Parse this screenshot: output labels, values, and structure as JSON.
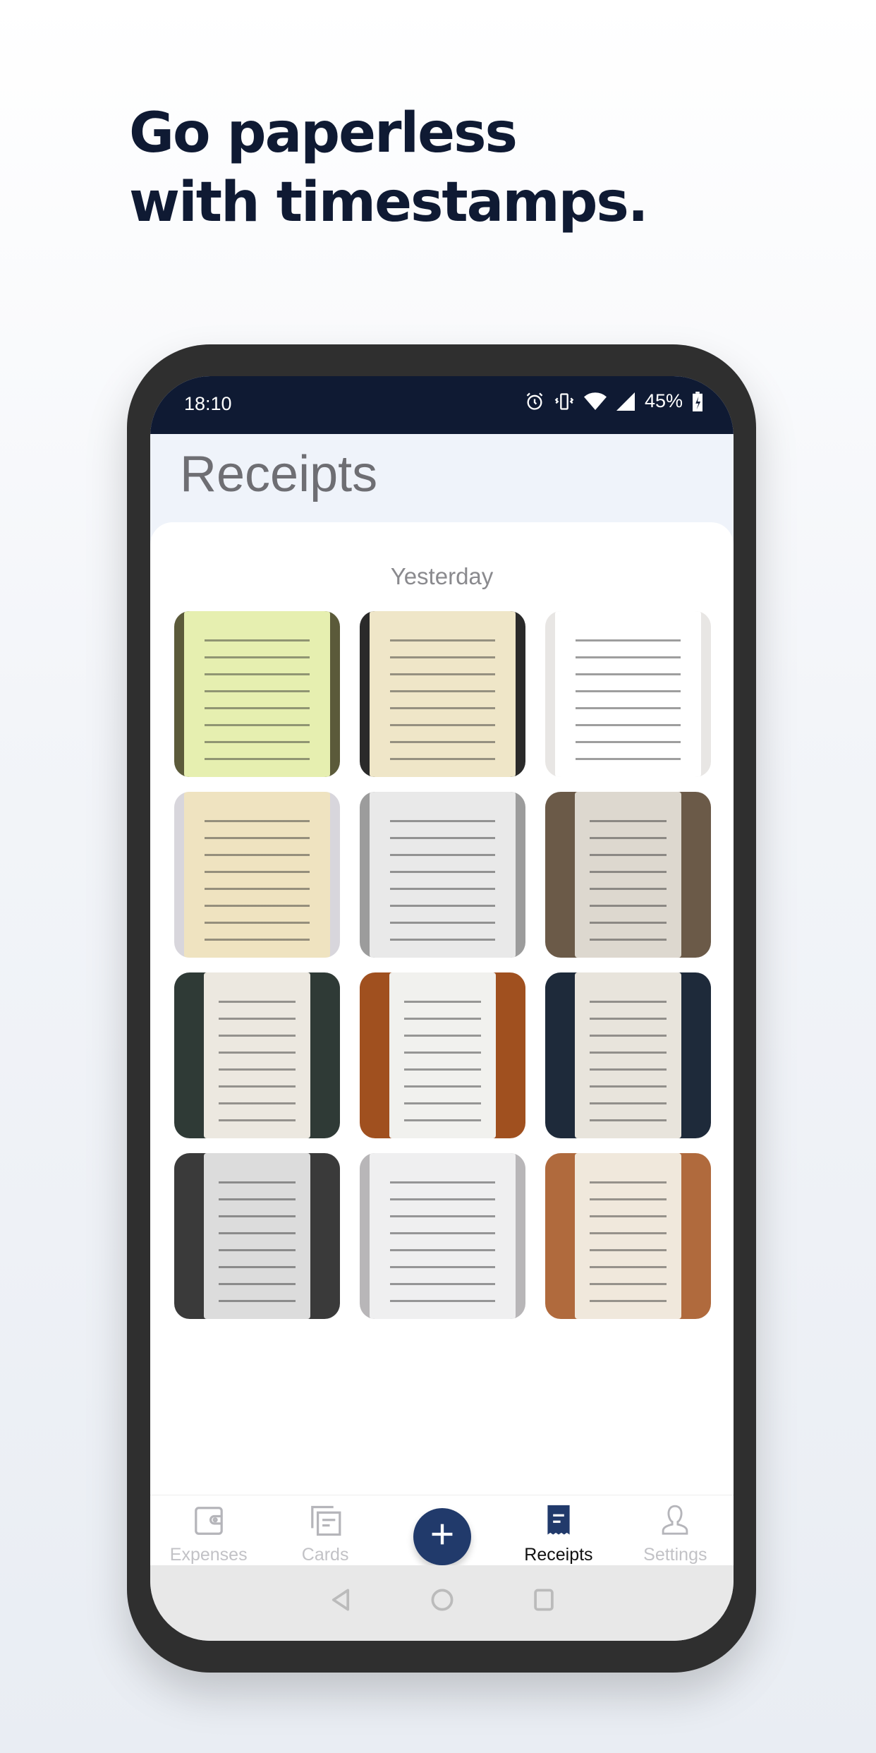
{
  "headline": {
    "line1": "Go paperless",
    "line2": "with timestamps."
  },
  "status_bar": {
    "time": "18:10",
    "battery": "45%",
    "icons": [
      "alarm-icon",
      "vibrate-icon",
      "wifi-icon",
      "signal-icon",
      "battery-charging-icon"
    ]
  },
  "screen": {
    "title": "Receipts",
    "section_label": "Yesterday"
  },
  "receipts": [
    {
      "bg": "#5b5a3a",
      "paper": "#e6efb0"
    },
    {
      "bg": "#2a2a2a",
      "paper": "#efe6c8"
    },
    {
      "bg": "#e8e6e4",
      "paper": "#ffffff"
    },
    {
      "bg": "#d8d6dc",
      "paper": "#efe3c0"
    },
    {
      "bg": "#9c9c9c",
      "paper": "#e9e9e9"
    },
    {
      "bg": "#6b5a48",
      "paper": "#ddd8cf"
    },
    {
      "bg": "#2f3a36",
      "paper": "#ece8e0"
    },
    {
      "bg": "#a0501f",
      "paper": "#f1f1ee"
    },
    {
      "bg": "#1e2a3a",
      "paper": "#e8e4dc"
    },
    {
      "bg": "#3a3a3a",
      "paper": "#dcdcdc"
    },
    {
      "bg": "#b8b6b8",
      "paper": "#efeff0"
    },
    {
      "bg": "#b06a3d",
      "paper": "#f0e8dc"
    }
  ],
  "nav": {
    "items": [
      {
        "label": "Expenses",
        "icon": "wallet-icon"
      },
      {
        "label": "Cards",
        "icon": "cards-icon"
      },
      {
        "label": "Receipts",
        "icon": "receipt-icon",
        "active": true
      },
      {
        "label": "Settings",
        "icon": "user-icon"
      }
    ],
    "add_icon": "plus-icon"
  },
  "colors": {
    "accent": "#213a6b",
    "status_bar": "#0f1a33",
    "headline": "#0f1a33"
  }
}
